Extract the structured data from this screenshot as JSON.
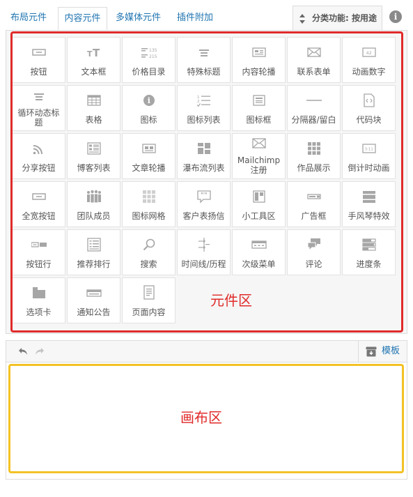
{
  "tabs": [
    "布局元件",
    "内容元件",
    "多媒体元件",
    "插件附加"
  ],
  "sort_button": {
    "label": "分类功能: 按用途",
    "icon": "sort-arrows-icon"
  },
  "info_icon": "i",
  "elements": [
    {
      "label": "按钮",
      "icon": "button"
    },
    {
      "label": "文本框",
      "icon": "textbox"
    },
    {
      "label": "价格目录",
      "icon": "price"
    },
    {
      "label": "特殊标题",
      "icon": "heading"
    },
    {
      "label": "内容轮播",
      "icon": "carousel"
    },
    {
      "label": "联系表单",
      "icon": "contact"
    },
    {
      "label": "动画数字",
      "icon": "counter"
    },
    {
      "label": "循环动态标题",
      "icon": "heading"
    },
    {
      "label": "表格",
      "icon": "table"
    },
    {
      "label": "图标",
      "icon": "info"
    },
    {
      "label": "图标列表",
      "icon": "iconlist"
    },
    {
      "label": "图标框",
      "icon": "iconbox"
    },
    {
      "label": "分隔器/留白",
      "icon": "divider"
    },
    {
      "label": "代码块",
      "icon": "code"
    },
    {
      "label": "分享按钮",
      "icon": "share"
    },
    {
      "label": "博客列表",
      "icon": "bloglist"
    },
    {
      "label": "文章轮播",
      "icon": "postslider"
    },
    {
      "label": "瀑布流列表",
      "icon": "masonry"
    },
    {
      "label": "Mailchimp 注册",
      "icon": "mailchimp"
    },
    {
      "label": "作品展示",
      "icon": "portfolio"
    },
    {
      "label": "倒计时动画",
      "icon": "countdown"
    },
    {
      "label": "全宽按钮",
      "icon": "button"
    },
    {
      "label": "团队成员",
      "icon": "team"
    },
    {
      "label": "图标网格",
      "icon": "icongrid"
    },
    {
      "label": "客户表扬信",
      "icon": "testimonial"
    },
    {
      "label": "小工具区",
      "icon": "widget"
    },
    {
      "label": "广告框",
      "icon": "promo"
    },
    {
      "label": "手风琴特效",
      "icon": "accordion"
    },
    {
      "label": "按钮行",
      "icon": "buttonrow"
    },
    {
      "label": "推荐排行",
      "icon": "catalog"
    },
    {
      "label": "搜索",
      "icon": "search"
    },
    {
      "label": "时间线/历程",
      "icon": "timeline"
    },
    {
      "label": "次级菜单",
      "icon": "submenu"
    },
    {
      "label": "评论",
      "icon": "comments"
    },
    {
      "label": "进度条",
      "icon": "progress"
    },
    {
      "label": "选项卡",
      "icon": "tabs"
    },
    {
      "label": "通知公告",
      "icon": "notification"
    },
    {
      "label": "页面内容",
      "icon": "page"
    }
  ],
  "element_zone_label": "元件区",
  "toolbar": {
    "template_label": "模板"
  },
  "canvas_zone_label": "画布区",
  "colors": {
    "element_zone_border": "#e02a2a",
    "canvas_zone_border": "#f3c226",
    "link": "#1f74b0"
  }
}
